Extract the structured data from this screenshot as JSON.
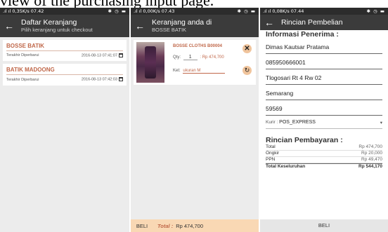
{
  "caption": "view of the purchasing input page.",
  "panel1": {
    "status_left": ".ıl ıl 0,35K/s 07.42",
    "status_right": "✱ ◷ ▬",
    "title": "Daftar Keranjang",
    "subtitle": "Pilih keranjang untuk checkout",
    "stores": [
      {
        "name": "BOSSE BATIK",
        "label": "Terakhir Diperbarui",
        "date": "2016-08-13 07:41:07"
      },
      {
        "name": "BATIK MADOONG",
        "label": "Terakhir Diperbarui",
        "date": "2016-08-13 07:42:03"
      }
    ]
  },
  "panel2": {
    "status_left": ".ıl ıl 0,00K/s 07.43",
    "status_right": "✱ ◷ ▬",
    "title": "Keranjang anda di",
    "subtitle": "BOSSE BATIK",
    "item": {
      "name": "BOSSE CLOTHS B00004",
      "qty_label": "Qty:",
      "qty": "1",
      "price": ": Rp 474,700",
      "note_label": "Ket:",
      "note": "ukuran M"
    },
    "beli": "BELI",
    "total_label": "Total :",
    "total_value": "Rp 474,700"
  },
  "panel3": {
    "status_left": ".ıl ıl 0,08K/s 07.44",
    "status_right": "✱ ◷ ▬",
    "title": "Rincian Pembelian",
    "recipient_heading": "Informasi Penerima :",
    "fields": [
      "Dimas Kautsar Pratama",
      "085950666001",
      "Tlogosari Rt 4 Rw 02",
      "Semarang",
      "59569"
    ],
    "kurir_label": "Kurir :",
    "kurir_value": "POS_EXPRESS",
    "payment_heading": "Rincian Pembayaran :",
    "rows": [
      {
        "label": "Total",
        "value": "Rp 474,700"
      },
      {
        "label": "Ongkir",
        "value": "Rp 20,000"
      },
      {
        "label": "PPN",
        "value": "Rp 49,470"
      }
    ],
    "grand_label": "Total Keseluruhan",
    "grand_value": "Rp 544,170",
    "beli": "BELI"
  }
}
